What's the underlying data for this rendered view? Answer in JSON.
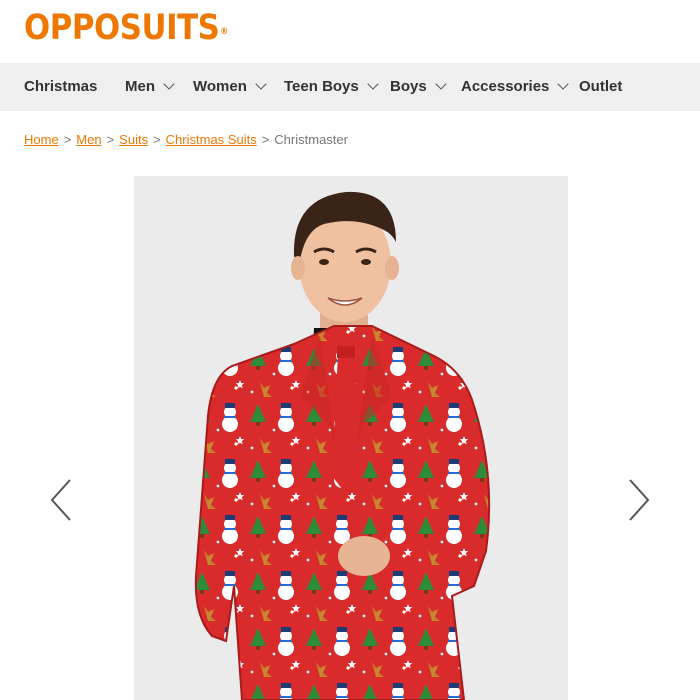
{
  "brand": {
    "name": "OPPOSUITS",
    "trademark": "®"
  },
  "nav": {
    "items": [
      {
        "label": "Christmas",
        "has_dropdown": false
      },
      {
        "label": "Men",
        "has_dropdown": true
      },
      {
        "label": "Women",
        "has_dropdown": true
      },
      {
        "label": "Teen Boys",
        "has_dropdown": true
      },
      {
        "label": "Boys",
        "has_dropdown": true
      },
      {
        "label": "Accessories",
        "has_dropdown": true
      },
      {
        "label": "Outlet",
        "has_dropdown": false
      }
    ]
  },
  "breadcrumb": {
    "links": [
      "Home",
      "Men",
      "Suits",
      "Christmas Suits"
    ],
    "current": "Christmaster",
    "separator": ">"
  },
  "gallery": {
    "image_alt": "Christmaster",
    "prev_icon": "chevron-left-icon",
    "next_icon": "chevron-right-icon"
  },
  "colors": {
    "brand_orange": "#ee7700",
    "nav_bg": "#efefef",
    "nav_text": "#333333",
    "suit_red": "#d92b2b",
    "gallery_bg": "#ebebeb"
  }
}
